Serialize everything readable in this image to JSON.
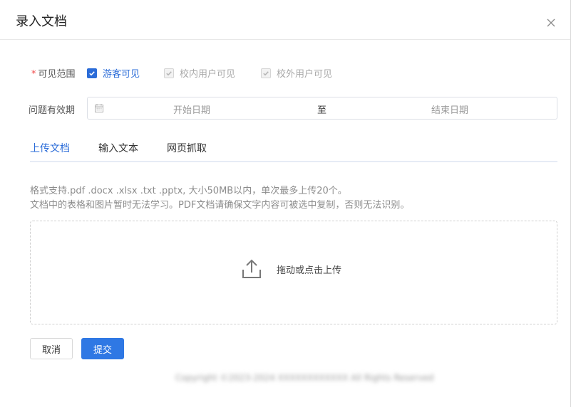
{
  "dialog": {
    "title": "录入文档"
  },
  "visibility": {
    "required_mark": "*",
    "label": "可见范围",
    "options": [
      {
        "label": "游客可见",
        "checked": true,
        "disabled": false
      },
      {
        "label": "校内用户可见",
        "checked": true,
        "disabled": true
      },
      {
        "label": "校外用户可见",
        "checked": true,
        "disabled": true
      }
    ]
  },
  "validity": {
    "label": "问题有效期",
    "start_placeholder": "开始日期",
    "separator": "至",
    "end_placeholder": "结束日期"
  },
  "tabs": [
    {
      "label": "上传文档",
      "active": true
    },
    {
      "label": "输入文本",
      "active": false
    },
    {
      "label": "网页抓取",
      "active": false
    }
  ],
  "hints": {
    "line1": "格式支持.pdf .docx .xlsx .txt .pptx, 大小50MB以内，单次最多上传20个。",
    "line2": "文档中的表格和图片暂时无法学习。PDF文档请确保文字内容可被选中复制，否则无法识别。"
  },
  "dropzone": {
    "text": "拖动或点击上传"
  },
  "buttons": {
    "cancel": "取消",
    "submit": "提交"
  },
  "footer": {
    "copyright": "Copyright ©2023-2024 XXXXXXXXXXXX All Rights Reserved"
  },
  "colors": {
    "primary": "#2b6cd8",
    "submit_bg": "#2f78e4",
    "required": "#f04848",
    "disabled_text": "#a8a8a8"
  }
}
